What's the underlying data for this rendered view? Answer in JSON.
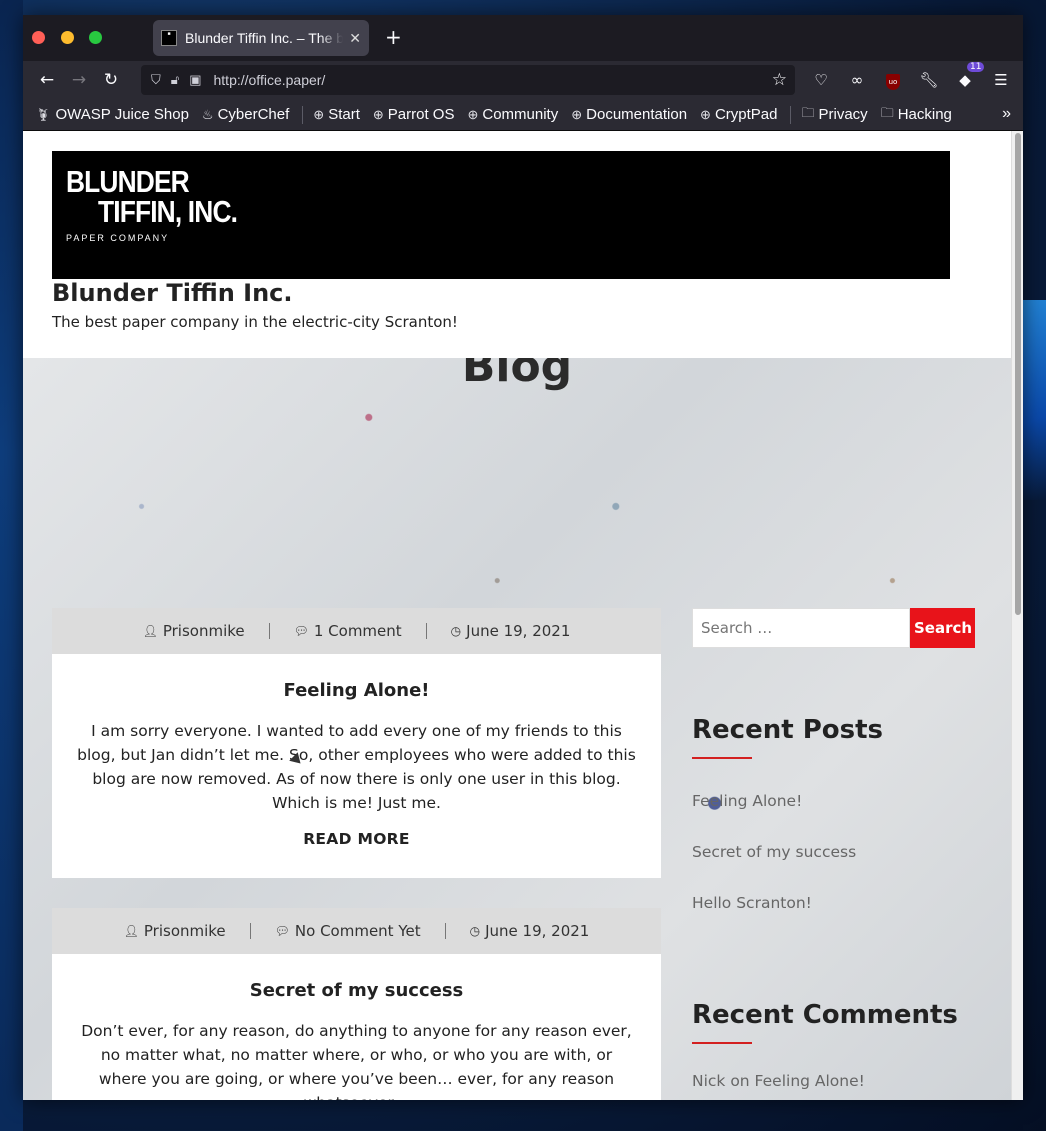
{
  "browser": {
    "tab_title": "Blunder Tiffin Inc. – The best paper company in the electric-city Scranton!",
    "new_tab": "+",
    "url": "http://office.paper/",
    "extension_badge": "11",
    "bookmarks": [
      {
        "label": "OWASP Juice Shop",
        "icon": "juice-icon"
      },
      {
        "label": "CyberChef",
        "icon": "chef-icon"
      },
      {
        "label": "Start",
        "icon": "globe-icon"
      },
      {
        "label": "Parrot OS",
        "icon": "globe-icon"
      },
      {
        "label": "Community",
        "icon": "globe-icon"
      },
      {
        "label": "Documentation",
        "icon": "globe-icon"
      },
      {
        "label": "CryptPad",
        "icon": "globe-icon"
      },
      {
        "label": "Privacy",
        "icon": "folder-icon"
      },
      {
        "label": "Hacking",
        "icon": "folder-icon"
      }
    ]
  },
  "site": {
    "logo_line1": "BLUNDER",
    "logo_line2": "TIFFIN, INC.",
    "logo_line3": "PAPER COMPANY",
    "title": "Blunder Tiffin Inc.",
    "tagline": "The best paper company in the electric-city Scranton!",
    "hero_title": "Blog"
  },
  "posts": [
    {
      "author": "Prisonmike",
      "comments": "1 Comment",
      "date": "June 19, 2021",
      "title": "Feeling Alone!",
      "excerpt": "I am sorry everyone. I wanted to add every one of my friends to this blog, but Jan didn’t let me. So, other employees who were added to this blog are now removed. As of now there is only one user in this blog. Which is me! Just me.",
      "read_more": "READ MORE"
    },
    {
      "author": "Prisonmike",
      "comments": "No Comment Yet",
      "date": "June 19, 2021",
      "title": "Secret of my success",
      "excerpt": "Don’t ever, for any reason, do anything to anyone for any reason ever, no matter what, no matter where, or who, or who you are with, or where you are going, or where you’ve been… ever, for any reason whatsoever…"
    }
  ],
  "sidebar": {
    "search_placeholder": "Search …",
    "search_button": "Search",
    "recent_posts_title": "Recent Posts",
    "recent_posts": [
      "Feeling Alone!",
      "Secret of my success",
      "Hello Scranton!"
    ],
    "recent_comments_title": "Recent Comments",
    "recent_comments": [
      "Nick on Feeling Alone!"
    ]
  },
  "colors": {
    "accent_red": "#e8131a",
    "meta_bar": "#dcdcdc"
  }
}
